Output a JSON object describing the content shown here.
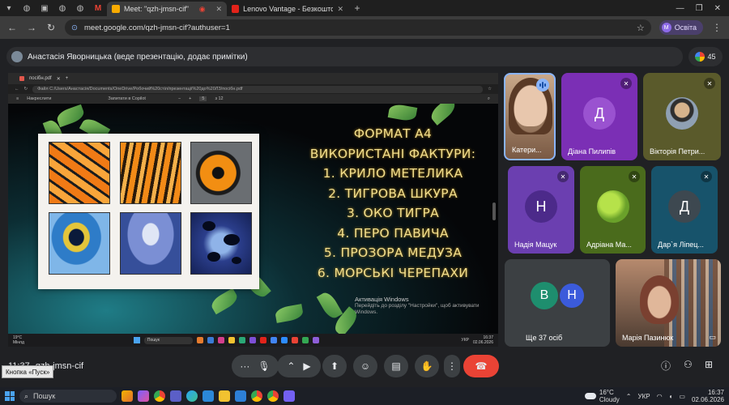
{
  "browser": {
    "tabs": [
      {
        "label": "Meet: \"qzh-jmsn-cif\"",
        "active": true
      },
      {
        "label": "Lenovo Vantage - Безкоштовн",
        "active": false
      }
    ],
    "new_tab_icon": "plus-icon",
    "url": "meet.google.com/qzh-jmsn-cif?authuser=1",
    "profile_label": "Освіта",
    "profile_initial": "M"
  },
  "meet": {
    "presenter_text": "Анастасія Яворницька (веде презентацію, додає примітки)",
    "people_count": "45",
    "meeting_code": "qzh-jmsn-cif",
    "meeting_code_prefix": "11:37",
    "tooltip": "Кнопка «Пуск»"
  },
  "shared_screen": {
    "tab_label": "посібн.pdf",
    "path": "C:/Users/Анастасія/Documents/OneDrive/Робочий%20стіл/презентації%20до%20ЛЗ/посібн.pdf",
    "path_label": "Файл",
    "pdf_toolbar": {
      "draw": "Накреслити",
      "ask_copilot": "Запитати в Copilot",
      "page": "5",
      "pages": "з 12"
    },
    "slide_lines": [
      "ФОРМАТ А4",
      "ВИКОРИСТАНІ ФАКТУРИ:",
      "1. КРИЛО МЕТЕЛИКА",
      "2. ТИГРОВА ШКУРА",
      "3. ОКО ТИГРА",
      "4. ПЕРО ПАВИЧА",
      "5. ПРОЗОРА МЕДУЗА",
      "6. МОРСЬКІ ЧЕРЕПАХИ"
    ],
    "win_activation_title": "Активація Windows",
    "win_activation_body": "Перейдіть до розділу \"Настройки\", щоб активувати Windows.",
    "taskbar": {
      "temp": "19°C",
      "weather": "Мінлд",
      "search": "Пошук",
      "lang": "УКР",
      "time": "16:37",
      "date": "02.06.2026"
    }
  },
  "participants": [
    {
      "name": "Катери...",
      "kind": "video",
      "speaking": true
    },
    {
      "name": "Діана Пилипів",
      "initial": "Д",
      "color": "#7b2fb5",
      "muted": true
    },
    {
      "name": "Вікторія Петри...",
      "kind": "photo",
      "muted": true
    },
    {
      "name": "Надія Мацук",
      "initial": "Н",
      "color": "#6b3fb0",
      "muted": true
    },
    {
      "name": "Адріана Ма...",
      "kind": "apple",
      "muted": true
    },
    {
      "name": "Дар`я Ліпец...",
      "initial": "Д",
      "color": "#17536b",
      "muted": true
    },
    {
      "name": "Ще 37 осіб",
      "initials": [
        "В",
        "Н"
      ]
    },
    {
      "name": "Марія Пазинюк",
      "kind": "video"
    }
  ],
  "windows_taskbar": {
    "search": "Пошук",
    "weather_temp": "16°C",
    "weather_text": "Cloudy",
    "lang": "УКР",
    "time": "16:37",
    "date": "02.06.2026"
  },
  "colors": {
    "meet_bg": "#202124",
    "end_call": "#ea4335",
    "slide_text": "#f3df8d"
  }
}
